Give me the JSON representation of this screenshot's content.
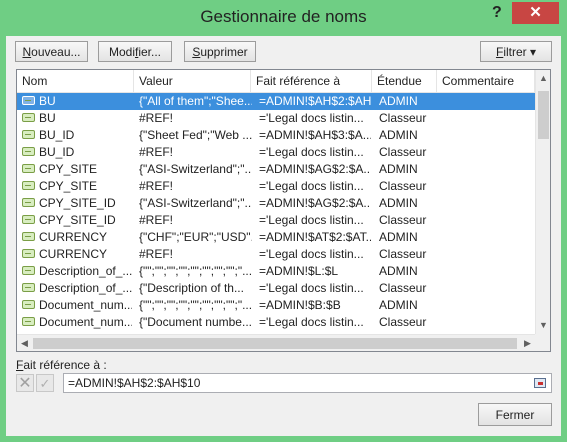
{
  "window": {
    "title": "Gestionnaire de noms",
    "help": "?",
    "close": "✕"
  },
  "toolbar": {
    "new_underline": "N",
    "new_rest": "ouveau...",
    "edit_pre": "Modi",
    "edit_underline": "f",
    "edit_rest": "ier...",
    "delete_underline": "S",
    "delete_rest": "upprimer",
    "filter_underline": "F",
    "filter_rest": "iltrer ▾"
  },
  "table": {
    "columns": [
      "Nom",
      "Valeur",
      "Fait référence à",
      "Étendue",
      "Commentaire"
    ],
    "rows": [
      {
        "name": "BU",
        "value": "{\"All of them\";\"Shee...",
        "ref": "=ADMIN!$AH$2:$AH...",
        "scope": "ADMIN",
        "comment": "",
        "selected": true
      },
      {
        "name": "BU",
        "value": "#REF!",
        "ref": "='Legal docs listin...",
        "scope": "Classeur",
        "comment": "",
        "selected": false
      },
      {
        "name": "BU_ID",
        "value": "{\"Sheet Fed\";\"Web ...",
        "ref": "=ADMIN!$AH$3:$A...",
        "scope": "ADMIN",
        "comment": "",
        "selected": false
      },
      {
        "name": "BU_ID",
        "value": "#REF!",
        "ref": "='Legal docs listin...",
        "scope": "Classeur",
        "comment": "",
        "selected": false
      },
      {
        "name": "CPY_SITE",
        "value": "{\"ASI-Switzerland\";\"...",
        "ref": "=ADMIN!$AG$2:$A...",
        "scope": "ADMIN",
        "comment": "",
        "selected": false
      },
      {
        "name": "CPY_SITE",
        "value": "#REF!",
        "ref": "='Legal docs listin...",
        "scope": "Classeur",
        "comment": "",
        "selected": false
      },
      {
        "name": "CPY_SITE_ID",
        "value": "{\"ASI-Switzerland\";\"...",
        "ref": "=ADMIN!$AG$2:$A...",
        "scope": "ADMIN",
        "comment": "",
        "selected": false
      },
      {
        "name": "CPY_SITE_ID",
        "value": "#REF!",
        "ref": "='Legal docs listin...",
        "scope": "Classeur",
        "comment": "",
        "selected": false
      },
      {
        "name": "CURRENCY",
        "value": "{\"CHF\";\"EUR\";\"USD\"...",
        "ref": "=ADMIN!$AT$2:$AT...",
        "scope": "ADMIN",
        "comment": "",
        "selected": false
      },
      {
        "name": "CURRENCY",
        "value": "#REF!",
        "ref": "='Legal docs listin...",
        "scope": "Classeur",
        "comment": "",
        "selected": false
      },
      {
        "name": "Description_of_...",
        "value": "{\"\";\"\";\"\";\"\";\"\";\"\";\"\";\"\";\"...",
        "ref": "=ADMIN!$L:$L",
        "scope": "ADMIN",
        "comment": "",
        "selected": false
      },
      {
        "name": "Description_of_...",
        "value": "{\"Description of th...",
        "ref": "='Legal docs listin...",
        "scope": "Classeur",
        "comment": "",
        "selected": false
      },
      {
        "name": "Document_num...",
        "value": "{\"\";\"\";\"\";\"\";\"\";\"\";\"\";\"\";\"...",
        "ref": "=ADMIN!$B:$B",
        "scope": "ADMIN",
        "comment": "",
        "selected": false
      },
      {
        "name": "Document_num...",
        "value": "{\"Document numbe...",
        "ref": "='Legal docs listin...",
        "scope": "Classeur",
        "comment": "",
        "selected": false
      }
    ]
  },
  "reference": {
    "label_underline": "F",
    "label_rest": "ait référence à :",
    "value": "=ADMIN!$AH$2:$AH$10"
  },
  "footer": {
    "close_label": "Fermer"
  },
  "colors": {
    "frame": "#6fce84",
    "selection": "#3c8fdd",
    "close_button": "#c84643"
  }
}
